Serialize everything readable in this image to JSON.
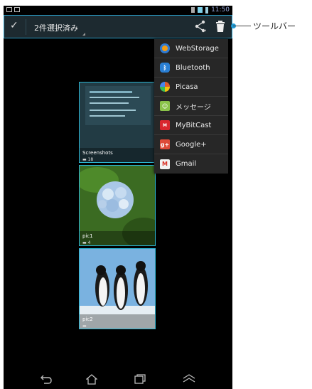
{
  "status_bar": {
    "time": "11:50"
  },
  "action_bar": {
    "selected_label": "2件選択済み"
  },
  "share_menu": {
    "items": [
      {
        "label": "WebStorage",
        "icon": "webstorage-icon",
        "color": "#f39c12"
      },
      {
        "label": "Bluetooth",
        "icon": "bluetooth-icon",
        "color": "#2a7fd4"
      },
      {
        "label": "Picasa",
        "icon": "picasa-icon",
        "color": "#e05b2c"
      },
      {
        "label": "メッセージ",
        "icon": "message-icon",
        "color": "#8bc34a"
      },
      {
        "label": "MyBitCast",
        "icon": "mybitcast-icon",
        "color": "#d9272e"
      },
      {
        "label": "Google+",
        "icon": "googleplus-icon",
        "color": "#dd4b39"
      },
      {
        "label": "Gmail",
        "icon": "gmail-icon",
        "color": "#d93025"
      }
    ]
  },
  "albums": [
    {
      "name": "Screenshots",
      "count": "18"
    },
    {
      "name": "pic1",
      "count": "4"
    },
    {
      "name": "pic2",
      "count": ""
    }
  ],
  "callout": {
    "label": "ツールバー"
  },
  "colors": {
    "accent": "#2bb3d0",
    "actionbar_bg": "#1d2a30",
    "menu_bg": "#272727"
  }
}
